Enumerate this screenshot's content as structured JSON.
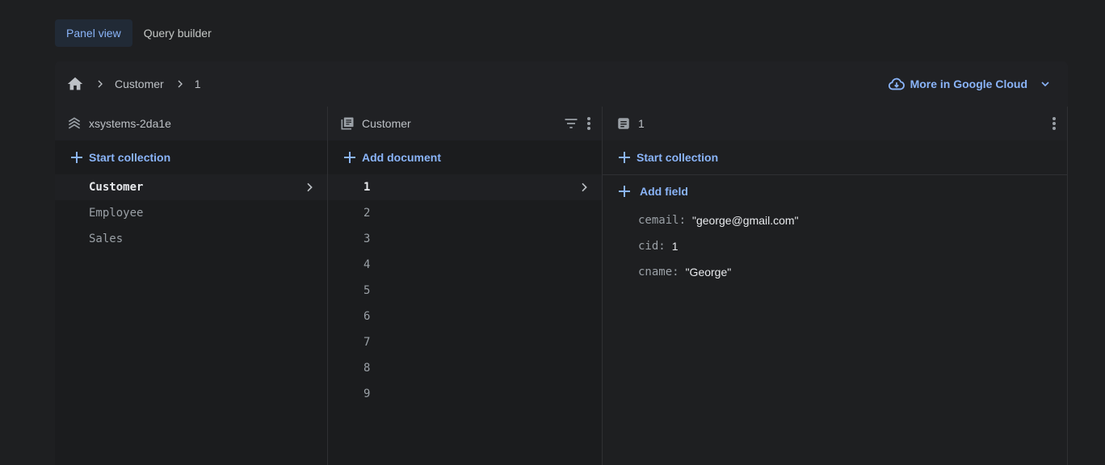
{
  "tabs": [
    {
      "label": "Panel view",
      "active": true
    },
    {
      "label": "Query builder",
      "active": false
    }
  ],
  "breadcrumb": {
    "home_icon": "home-icon",
    "items": [
      "Customer",
      "1"
    ]
  },
  "cloud_link": {
    "label": "More in Google Cloud",
    "icon": "cloud-icon"
  },
  "root_panel": {
    "title": "xsystems-2da1e",
    "icon": "database-stack-icon",
    "add_label": "Start collection",
    "collections": [
      "Customer",
      "Employee",
      "Sales"
    ],
    "selected": "Customer"
  },
  "collection_panel": {
    "title": "Customer",
    "icon": "collection-icon",
    "add_label": "Add document",
    "documents": [
      "1",
      "2",
      "3",
      "4",
      "5",
      "6",
      "7",
      "8",
      "9"
    ],
    "selected": "1"
  },
  "document_panel": {
    "title": "1",
    "icon": "document-icon",
    "add_collection_label": "Start collection",
    "add_field_label": "Add field",
    "fields": [
      {
        "key": "cemail:",
        "value": "\"george@gmail.com\""
      },
      {
        "key": "cid:",
        "value": "1"
      },
      {
        "key": "cname:",
        "value": "\"George\""
      }
    ]
  },
  "colors": {
    "accent": "#8ab4f8",
    "background": "#1e1f21"
  }
}
